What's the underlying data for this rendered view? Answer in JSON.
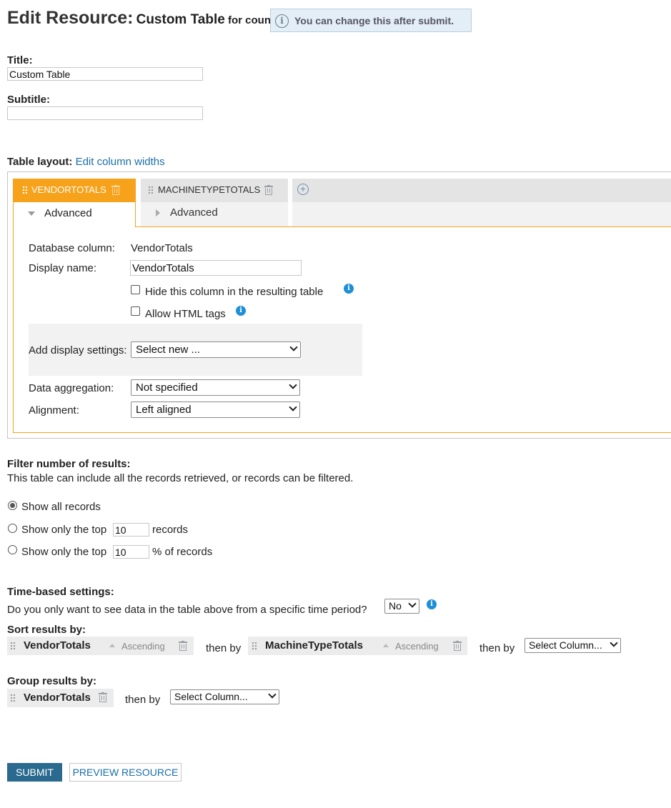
{
  "header": {
    "title": "Edit Resource:",
    "resource_name": "Custom Table",
    "resource_suffix": "for counts",
    "notice": "You can change this after submit."
  },
  "fields": {
    "title_label": "Title:",
    "title_value": "Custom Table",
    "subtitle_label": "Subtitle:",
    "subtitle_value": ""
  },
  "table_layout": {
    "label": "Table layout:",
    "edit_link": "Edit column widths",
    "tabs": [
      {
        "label": "VENDORTOTALS",
        "sub": "Advanced",
        "active": true
      },
      {
        "label": "MACHINETYPETOTALS",
        "sub": "Advanced",
        "active": false
      }
    ],
    "add_icon": "plus-circle-icon",
    "panel": {
      "db_column_label": "Database column:",
      "db_column_value": "VendorTotals",
      "display_name_label": "Display name:",
      "display_name_value": "VendorTotals",
      "hide_column_label": "Hide this column in the resulting table",
      "allow_html_label": "Allow HTML tags",
      "add_display_label": "Add display settings:",
      "add_display_value": "Select new ...",
      "aggregation_label": "Data aggregation:",
      "aggregation_value": "Not specified",
      "alignment_label": "Alignment:",
      "alignment_value": "Left aligned"
    }
  },
  "filter": {
    "heading": "Filter number of results:",
    "description": "This table can include all the records retrieved, or records can be filtered.",
    "opt_all": "Show all records",
    "opt_top_prefix": "Show only the top",
    "opt_top_value": "10",
    "opt_top_suffix": "records",
    "opt_pct_prefix": "Show only the top",
    "opt_pct_value": "10",
    "opt_pct_suffix": "% of records",
    "selected": "all"
  },
  "time": {
    "heading": "Time-based settings:",
    "question": "Do you only want to see data in the table above from a specific time period?",
    "value": "No"
  },
  "sort": {
    "heading": "Sort results by:",
    "items": [
      {
        "name": "VendorTotals",
        "order": "Ascending"
      },
      {
        "name": "MachineTypeTotals",
        "order": "Ascending"
      }
    ],
    "then_by": "then by",
    "select_placeholder": "Select Column..."
  },
  "group": {
    "heading": "Group results by:",
    "item": "VendorTotals",
    "then_by": "then by",
    "select_placeholder": "Select Column..."
  },
  "actions": {
    "submit": "SUBMIT",
    "preview": "PREVIEW RESOURCE"
  },
  "colors": {
    "accent_orange": "#f7a21b",
    "link_blue": "#1a6fa8",
    "submit_bg": "#2a6a8e",
    "notice_bg": "#e3eef6",
    "info_blue": "#1d8fd6"
  }
}
